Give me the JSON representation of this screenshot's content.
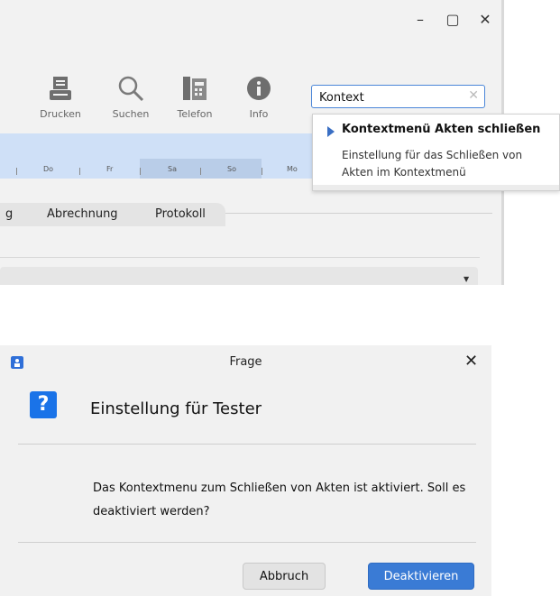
{
  "app": {
    "window_controls": {
      "minimize": "–",
      "maximize": "▢",
      "close": "✕"
    },
    "toolbar": [
      {
        "label": "Drucken",
        "icon": "printer-icon"
      },
      {
        "label": "Suchen",
        "icon": "search-icon"
      },
      {
        "label": "Telefon",
        "icon": "phone-icon"
      },
      {
        "label": "Info",
        "icon": "info-icon"
      }
    ],
    "search": {
      "value": "Kontext",
      "clear_icon": "✕"
    },
    "popup": {
      "title": "Kontextmenü Akten schließen",
      "description": "Einstellung für das Schließen von Akten im Kontextmenü"
    },
    "calendar_days": [
      "Do",
      "Fr",
      "Sa",
      "So",
      "Mo"
    ],
    "tabs": [
      "g",
      "Abrechnung",
      "Protokoll"
    ],
    "dropdown_arrow": "▼"
  },
  "dialog": {
    "title": "Frage",
    "close": "✕",
    "icon_glyph": "?",
    "heading": "Einstellung für Tester",
    "message": "Das Kontextmenu zum Schließen von Akten ist aktiviert. Soll es deaktiviert werden?",
    "cancel_label": "Abbruch",
    "ok_label": "Deaktivieren"
  },
  "colors": {
    "accent": "#3a7bd5",
    "calendar": "#cfe0f7",
    "question_icon": "#1a73e8"
  }
}
